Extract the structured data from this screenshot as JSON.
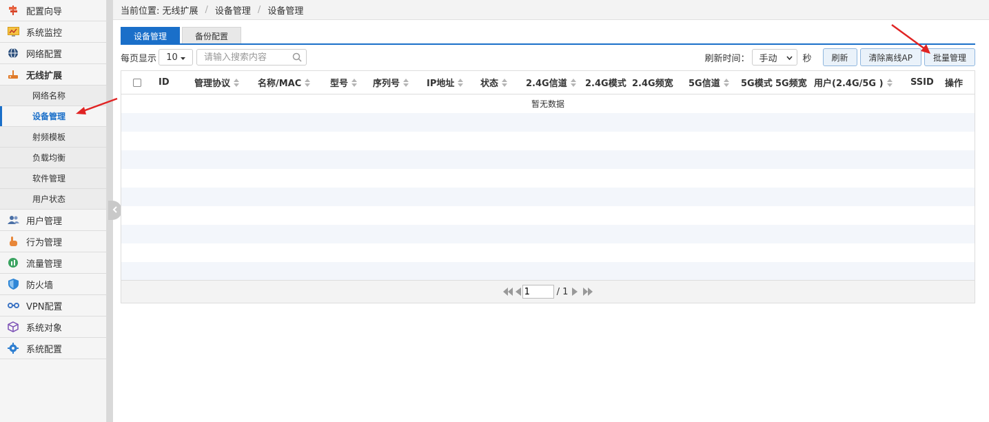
{
  "sidebar": {
    "items": [
      {
        "label": "配置向导",
        "icon": "signpost-icon"
      },
      {
        "label": "系统监控",
        "icon": "monitor-chart-icon"
      },
      {
        "label": "网络配置",
        "icon": "globe-network-icon"
      },
      {
        "label": "无线扩展",
        "icon": "router-icon"
      }
    ],
    "sub_items": [
      "网络名称",
      "设备管理",
      "射频模板",
      "负载均衡",
      "软件管理",
      "用户状态"
    ],
    "items_after": [
      {
        "label": "用户管理",
        "icon": "users-icon"
      },
      {
        "label": "行为管理",
        "icon": "hand-pointer-icon"
      },
      {
        "label": "流量管理",
        "icon": "traffic-icon"
      },
      {
        "label": "防火墙",
        "icon": "shield-icon"
      },
      {
        "label": "VPN配置",
        "icon": "vpn-link-icon"
      },
      {
        "label": "系统对象",
        "icon": "cube-icon"
      },
      {
        "label": "系统配置",
        "icon": "gear-icon"
      }
    ]
  },
  "breadcrumb": {
    "prefix": "当前位置: 无线扩展",
    "level2": "设备管理",
    "level3": "设备管理"
  },
  "tabs": [
    "设备管理",
    "备份配置"
  ],
  "toolbar": {
    "page_size_label": "每页显示",
    "page_size_value": "10",
    "search_placeholder": "请输入搜索内容",
    "refresh_time_label": "刷新时间：",
    "refresh_mode": "手动",
    "seconds_label": "秒",
    "refresh_button": "刷新",
    "clear_offline_button": "清除离线AP",
    "batch_button": "批量管理"
  },
  "table": {
    "columns": [
      "ID",
      "管理协议",
      "名称/MAC",
      "型号",
      "序列号",
      "IP地址",
      "状态",
      "2.4G信道",
      "2.4G模式",
      "2.4G频宽",
      "5G信道",
      "5G模式",
      "5G频宽",
      "用户(2.4G/5G )",
      "SSID",
      "操作"
    ],
    "empty_text": "暂无数据"
  },
  "pagination": {
    "current_page": "1",
    "total_text": "/ 1"
  },
  "colors": {
    "accent": "#1a6fc9",
    "arrow": "#e02424"
  }
}
